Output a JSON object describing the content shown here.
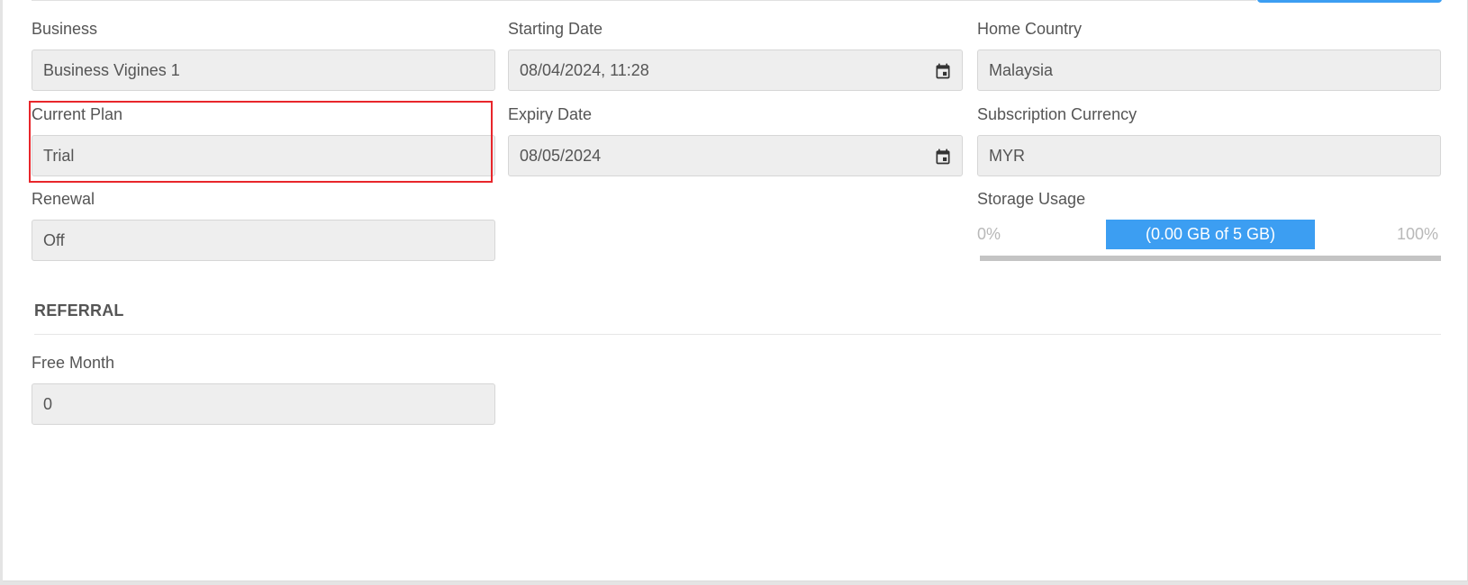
{
  "fields": {
    "business": {
      "label": "Business",
      "value": "Business Vigines 1"
    },
    "starting_date": {
      "label": "Starting Date",
      "value": "08/04/2024, 11:28"
    },
    "home_country": {
      "label": "Home Country",
      "value": "Malaysia"
    },
    "current_plan": {
      "label": "Current Plan",
      "value": "Trial"
    },
    "expiry_date": {
      "label": "Expiry Date",
      "value": "08/05/2024"
    },
    "subscription_currency": {
      "label": "Subscription Currency",
      "value": "MYR"
    },
    "renewal": {
      "label": "Renewal",
      "value": "Off"
    },
    "free_month": {
      "label": "Free Month",
      "value": "0"
    }
  },
  "storage": {
    "label": "Storage Usage",
    "min_label": "0%",
    "max_label": "100%",
    "bar_text": "(0.00 GB of 5 GB)",
    "used_gb": 0.0,
    "total_gb": 5
  },
  "referral": {
    "section_title": "REFERRAL"
  },
  "icons": {
    "date_picker": "calendar-icon"
  },
  "colors": {
    "accent": "#3c9ef2",
    "highlight": "#e8262b"
  }
}
